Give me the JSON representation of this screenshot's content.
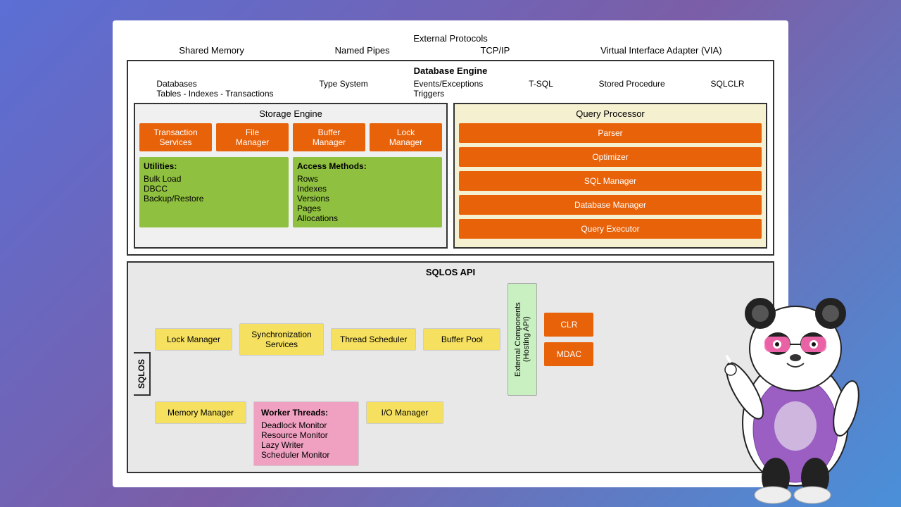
{
  "external_protocols": {
    "title": "External Protocols",
    "items": [
      "Shared Memory",
      "Named Pipes",
      "TCP/IP",
      "Virtual Interface Adapter (VIA)"
    ]
  },
  "db_engine": {
    "title": "Database Engine",
    "subtitle_left": "Databases\nTables - Indexes - Transactions",
    "subtitle_left2": "Type System",
    "subtitle_mid": "Events/Exceptions\nTriggers",
    "subtitle_right1": "T-SQL",
    "subtitle_right2": "Stored Procedure",
    "subtitle_right3": "SQLCLR"
  },
  "storage_engine": {
    "title": "Storage Engine",
    "buttons": [
      "Transaction\nServices",
      "File\nManager",
      "Buffer\nManager",
      "Lock\nManager"
    ],
    "utilities_title": "Utilities:",
    "utilities_items": [
      "Bulk Load",
      "DBCC",
      "Backup/Restore"
    ],
    "access_title": "Access Methods:",
    "access_items": [
      "Rows",
      "Indexes",
      "Versions",
      "Pages",
      "Allocations"
    ]
  },
  "query_processor": {
    "title": "Query Processor",
    "buttons": [
      "Parser",
      "Optimizer",
      "SQL Manager",
      "Database Manager",
      "Query Executor"
    ]
  },
  "sqlos": {
    "api_title": "SQLOS API",
    "label": "SQLOS",
    "lock_manager": "Lock Manager",
    "sync_services": "Synchronization\nServices",
    "thread_scheduler": "Thread Scheduler",
    "buffer_pool": "Buffer Pool",
    "memory_manager": "Memory Manager",
    "io_manager": "I/O Manager",
    "worker_threads_title": "Worker Threads:",
    "worker_threads_items": [
      "Deadlock Monitor",
      "Resource Monitor",
      "Lazy Writer",
      "Scheduler Monitor"
    ],
    "ext_components": "External Components\n(Hosting API)",
    "clr": "CLR",
    "mdac": "MDAC"
  }
}
